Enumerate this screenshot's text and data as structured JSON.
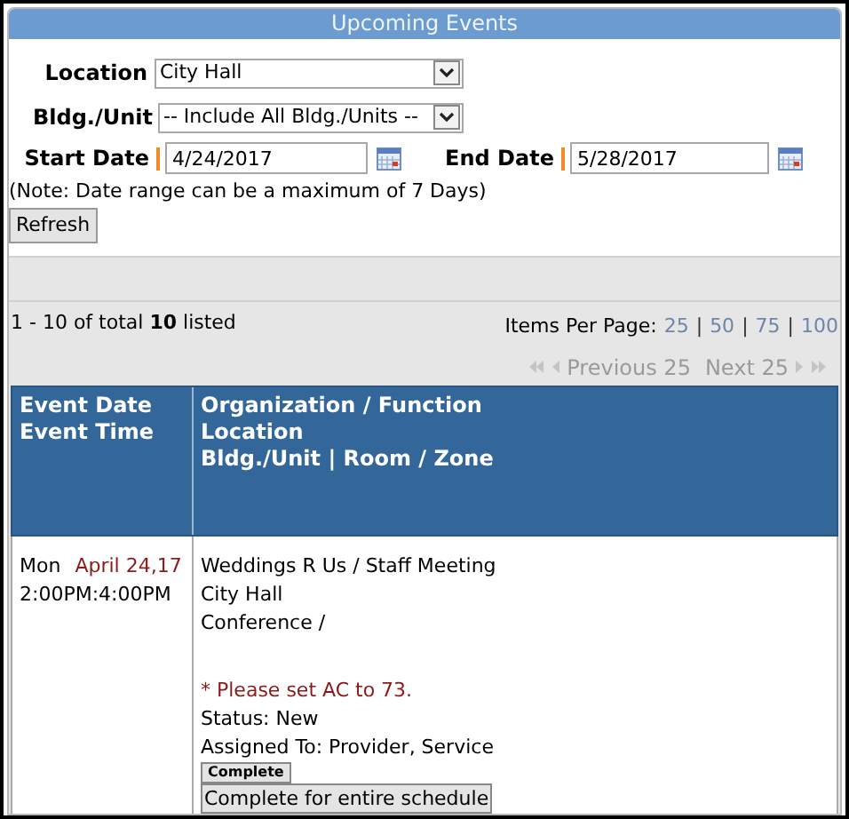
{
  "header": {
    "title": "Upcoming Events"
  },
  "form": {
    "location": {
      "label": "Location",
      "value": "City Hall"
    },
    "building": {
      "label": "Bldg./Unit",
      "value": "-- Include All Bldg./Units --"
    },
    "start_date": {
      "label": "Start Date",
      "value": "4/24/2017"
    },
    "end_date": {
      "label": "End Date",
      "value": "5/28/2017"
    },
    "note": "(Note: Date range can be a maximum of 7 Days)",
    "refresh_button": "Refresh"
  },
  "results": {
    "summary": "1 - 10 of total **10** listed",
    "items_per_page_label": "Items Per Page:",
    "page_sizes": [
      "25",
      "50",
      "75",
      "100"
    ],
    "separator": "|",
    "previous": {
      "label": "Previous 25",
      "disabled": true
    },
    "next": {
      "label": "Next 25",
      "disabled": true
    }
  },
  "table": {
    "columns": [
      {
        "lines": [
          "Event Date",
          "Event Time"
        ]
      },
      {
        "lines": [
          "Organization / Function",
          "Location",
          "Bldg./Unit | Room / Zone"
        ]
      }
    ],
    "rows": [
      {
        "day": "Mon",
        "date": "April 24,17",
        "time": "2:00PM:4:00PM",
        "organization_function": "Weddings R Us / Staff Meeting",
        "location": "City Hall",
        "bldg_room": "Conference /",
        "note": "* Please set AC to 73.",
        "status": "Status: New",
        "assigned_to": "Assigned To: Provider, Service",
        "buttons": [
          "Complete",
          "Complete for entire schedule"
        ]
      }
    ]
  }
}
